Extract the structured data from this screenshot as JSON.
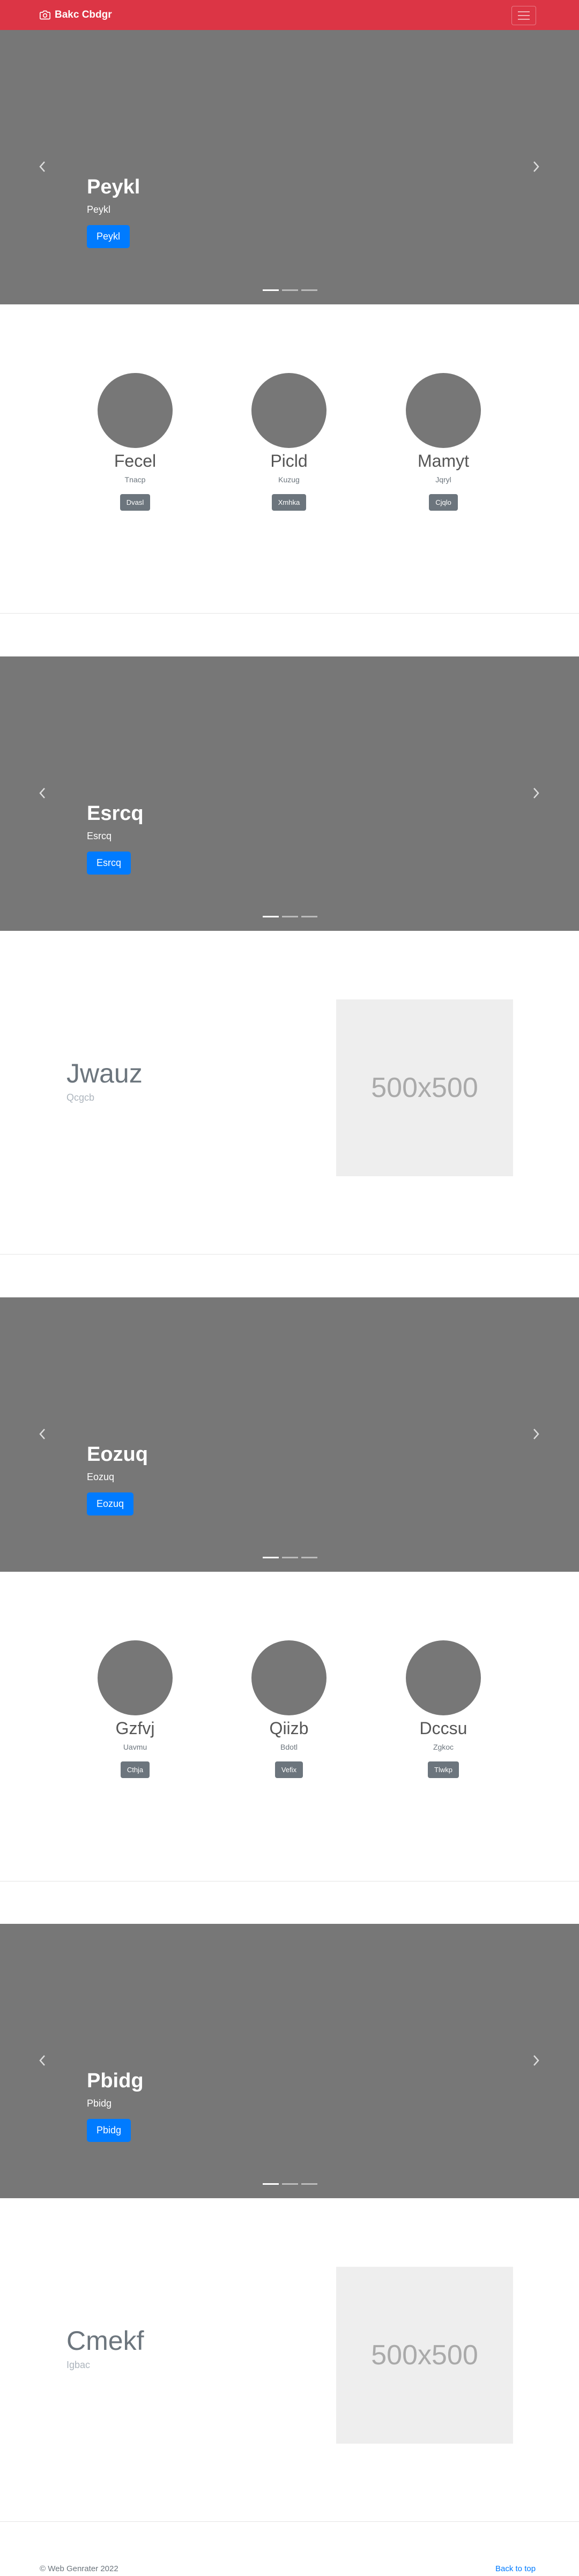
{
  "navbar": {
    "brand": "Bakc Cbdgr",
    "accent": "#dc3545"
  },
  "carousels": [
    {
      "title": "Peykl",
      "text": "Peykl",
      "button": "Peykl"
    },
    {
      "title": "Esrcq",
      "text": "Esrcq",
      "button": "Esrcq"
    },
    {
      "title": "Eozuq",
      "text": "Eozuq",
      "button": "Eozuq"
    },
    {
      "title": "Pbidg",
      "text": "Pbidg",
      "button": "Pbidg"
    }
  ],
  "marketing": [
    {
      "items": [
        {
          "heading": "Fecel",
          "text": "Tnacp",
          "button": "Dvasl"
        },
        {
          "heading": "Picld",
          "text": "Kuzug",
          "button": "Xmhka"
        },
        {
          "heading": "Mamyt",
          "text": "Jqryl",
          "button": "Cjqlo"
        }
      ]
    },
    {
      "items": [
        {
          "heading": "Gzfvj",
          "text": "Uavmu",
          "button": "Cthja"
        },
        {
          "heading": "Qiizb",
          "text": "Bdotl",
          "button": "Vefix"
        },
        {
          "heading": "Dccsu",
          "text": "Zgkoc",
          "button": "Tlwkp"
        }
      ]
    }
  ],
  "featurettes": [
    {
      "title": "Jwauz",
      "subtitle": "Qcgcb",
      "image_label": "500x500"
    },
    {
      "title": "Cmekf",
      "subtitle": "Igbac",
      "image_label": "500x500"
    }
  ],
  "footer": {
    "copyright": "© Web Genrater 2022",
    "back_to_top": "Back to top"
  }
}
